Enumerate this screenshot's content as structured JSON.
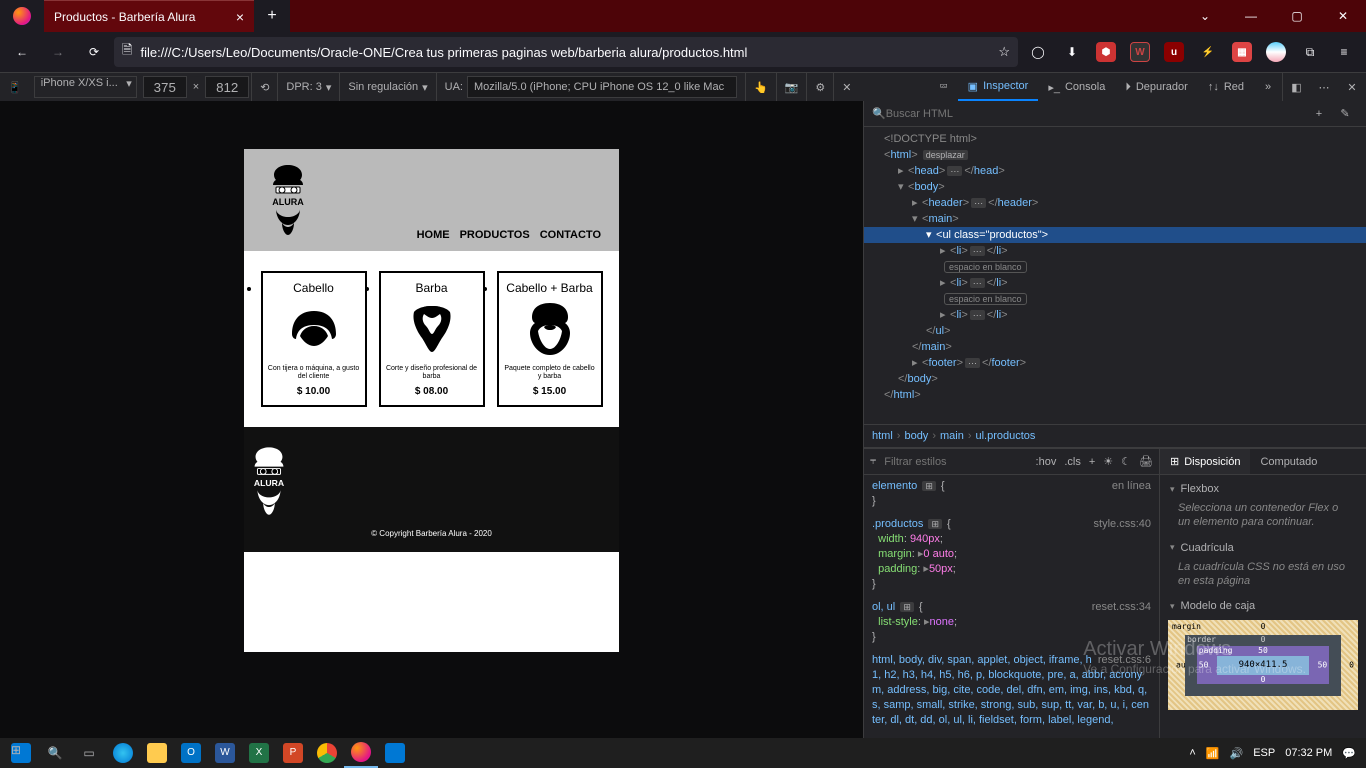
{
  "titlebar": {
    "tab_title": "Productos - Barbería Alura",
    "tab_close": "×",
    "newtab": "+",
    "chevron": "⌄",
    "min": "—",
    "max": "▢",
    "close": "✕"
  },
  "navbar": {
    "url": "file:///C:/Users/Leo/Documents/Oracle-ONE/Crea tus primeras paginas web/barberia alura/productos.html",
    "star": "☆"
  },
  "rdm": {
    "device": "iPhone X/XS i...",
    "w": "375",
    "h": "812",
    "x": "×",
    "dpr": "DPR: 3",
    "throttle": "Sin regulación",
    "ua_label": "UA:",
    "ua": "Mozilla/5.0 (iPhone; CPU iPhone OS 12_0 like Mac"
  },
  "dt_tabs": {
    "inspector": "Inspector",
    "console": "Consola",
    "debugger": "Depurador",
    "network": "Red"
  },
  "page": {
    "logo": "ALURA",
    "nav": {
      "home": "HOME",
      "productos": "PRODUCTOS",
      "contacto": "CONTACTO"
    },
    "products": [
      {
        "title": "Cabello",
        "desc": "Con tijera o máquina, a gusto del cliente",
        "price": "$ 10.00"
      },
      {
        "title": "Barba",
        "desc": "Corte y diseño profesional de barba",
        "price": "$ 08.00"
      },
      {
        "title": "Cabello + Barba",
        "desc": "Paquete completo de cabello y barba",
        "price": "$ 15.00"
      }
    ],
    "copyright": "© Copyright Barbería Alura - 2020"
  },
  "dom": {
    "search_ph": "Buscar HTML",
    "doctype": "<!DOCTYPE html>",
    "desplazar": "desplazar",
    "whitespace": "espacio en blanco",
    "ul_class": "productos"
  },
  "crumbs": {
    "html": "html",
    "body": "body",
    "main": "main",
    "ul": "ul.productos",
    "sep": "›"
  },
  "rules": {
    "filter_ph": "Filtrar estilos",
    "hov": ":hov",
    "cls": ".cls",
    "inline": "en línea",
    "element": "elemento",
    "src1": "style.css:40",
    "sel1": ".productos",
    "p1n": "width",
    "p1v": "940px",
    "p2n": "margin",
    "p2v": "0 auto",
    "p3n": "padding",
    "p3v": "50px",
    "src2": "reset.css:34",
    "sel2": "ol, ul",
    "p4n": "list-style",
    "p4v": "none",
    "src3": "reset.css:6",
    "sel3": "html, body, div, span, applet, object, iframe, h1, h2, h3, h4, h5, h6, p, blockquote, pre, a, abbr, acronym, address, big, cite, code, del, dfn, em, img, ins, kbd, q, s, samp, small, strike, strong, sub, sup, tt, var, b, u, i, center, dl, dt, dd, ol, ul, li, fieldset, form, label, legend,"
  },
  "layout": {
    "tab_layout": "Disposición",
    "tab_computed": "Computado",
    "flexbox_h": "Flexbox",
    "flexbox_msg": "Selecciona un contenedor Flex o un elemento para continuar.",
    "grid_h": "Cuadrícula",
    "grid_msg": "La cuadrícula CSS no está en uso en esta página",
    "boxmodel_h": "Modelo de caja",
    "margin_l": "margin",
    "border_l": "border",
    "padding_l": "padding",
    "content": "940×411.5",
    "m_top": "0",
    "m_right": "0",
    "m_left": "auto",
    "b_val": "0",
    "p_val": "50"
  },
  "watermark": {
    "l1": "Activar Windows",
    "l2": "Ve a Configuración para activar Windows."
  },
  "taskbar": {
    "lang": "ESP",
    "time": "07:32 PM"
  }
}
